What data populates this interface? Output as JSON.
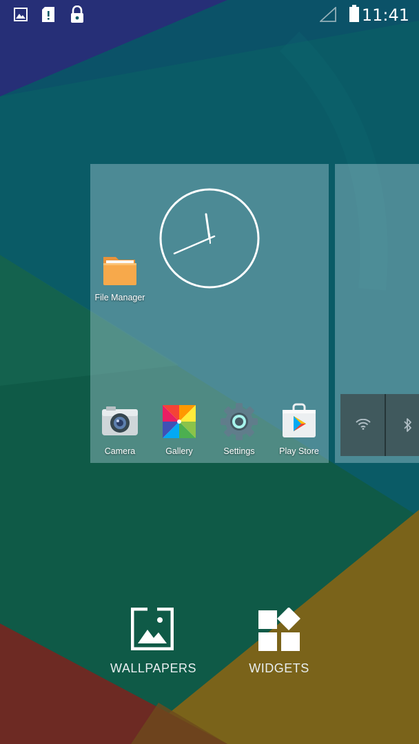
{
  "status_bar": {
    "time": "11:41",
    "left_icons": [
      "image-notification-icon",
      "sd-card-alert-icon",
      "lock-icon"
    ],
    "right_icons": [
      "signal-icon",
      "battery-icon"
    ]
  },
  "workspace": {
    "folder_app": {
      "label": "File Manager",
      "icon": "folder-icon"
    },
    "clock_widget": {
      "icon": "analog-clock"
    },
    "hotseat": [
      {
        "label": "Camera",
        "icon": "camera-icon"
      },
      {
        "label": "Gallery",
        "icon": "gallery-icon"
      },
      {
        "label": "Settings",
        "icon": "settings-icon"
      },
      {
        "label": "Play Store",
        "icon": "play-store-icon"
      }
    ],
    "next_page": {
      "widget_icons": [
        "wifi-icon",
        "bluetooth-icon"
      ]
    }
  },
  "overview": {
    "wallpapers_label": "WALLPAPERS",
    "widgets_label": "WIDGETS"
  },
  "colors": {
    "wallpaper_teal": "#0a5f68",
    "wallpaper_green": "#0e5a48",
    "wallpaper_indigo": "#27307a",
    "wallpaper_olive": "#7a6419",
    "wallpaper_red": "#6e2a22"
  }
}
